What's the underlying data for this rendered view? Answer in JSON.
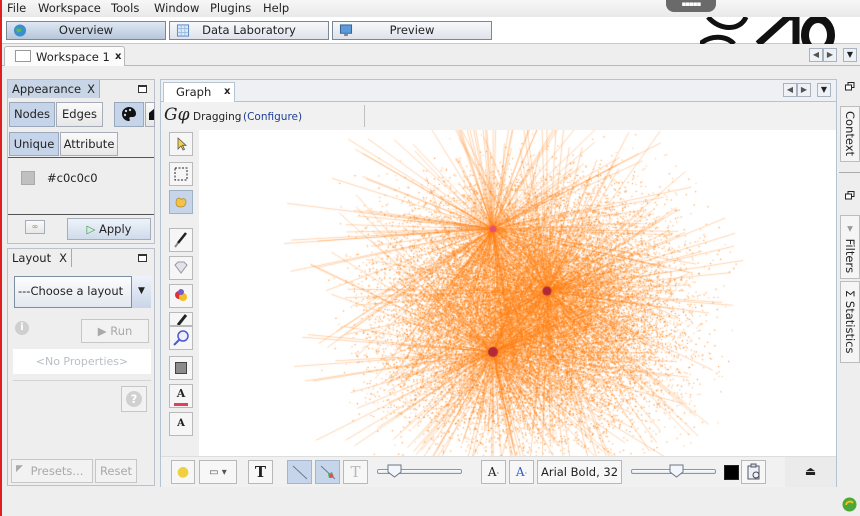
{
  "menu": [
    "File",
    "Workspace",
    "Tools",
    "Window",
    "Plugins",
    "Help"
  ],
  "notch_label": "▪▪▪▪▪",
  "perspectives": [
    {
      "label": "Overview",
      "icon": "globe-icon",
      "selected": true
    },
    {
      "label": "Data Laboratory",
      "icon": "table-icon",
      "selected": false
    },
    {
      "label": "Preview",
      "icon": "monitor-icon",
      "selected": false
    }
  ],
  "workspace_tab": {
    "label": "Workspace 1",
    "close": "x"
  },
  "appearance": {
    "title": "Appearance",
    "close": "X",
    "element_tabs": [
      "Nodes",
      "Edges"
    ],
    "mode_tabs": [
      "Unique",
      "Attribute"
    ],
    "color_value": "#c0c0c0",
    "apply_label": "Apply"
  },
  "layout": {
    "title": "Layout",
    "close": "X",
    "selected_layout": "---Choose a layout",
    "run_label": "Run",
    "properties_placeholder": "<No Properties>",
    "presets_label": "Presets...",
    "reset_label": "Reset"
  },
  "graph": {
    "tab_label": "Graph",
    "tab_close": "x",
    "mode_label": "Dragging",
    "configure_link": "(Configure)",
    "logo_text": "Gφ",
    "node_color": "#ff7f0e",
    "hub_color": "#b02a3a",
    "font_label": "Arial Bold, 32",
    "edge_scale_fraction": 0.2,
    "label_size_fraction": 0.53,
    "label_color": "#000000"
  },
  "right_tabs": {
    "context": "Context",
    "filters": "Filters",
    "statistics": "Statistics"
  },
  "colors": {
    "accent_selected": "#c5d4e9",
    "panel_tab": "#c8d5e6"
  }
}
